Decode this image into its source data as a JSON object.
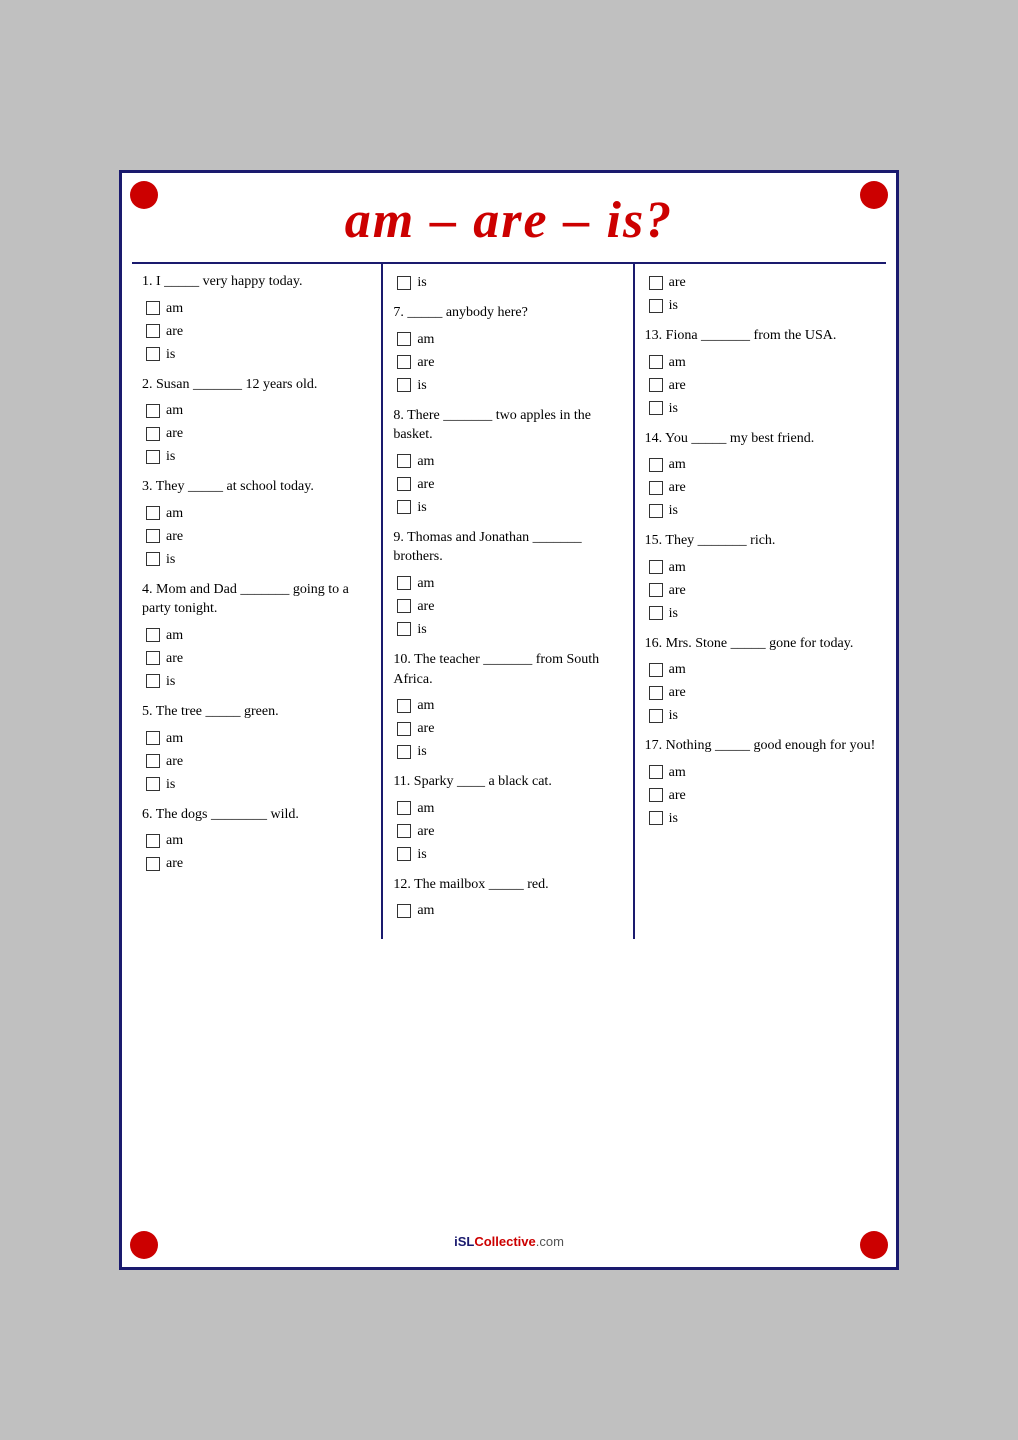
{
  "title": "am – are – is?",
  "watermark": "iSLCollective.com",
  "columns": [
    {
      "questions": [
        {
          "id": "q1",
          "text": "1. I _____ very happy today.",
          "options": [
            "am",
            "are",
            "is"
          ]
        },
        {
          "id": "q2",
          "text": "2. Susan _______ 12 years old.",
          "options": [
            "am",
            "are",
            "is"
          ]
        },
        {
          "id": "q3",
          "text": "3. They _____ at school today.",
          "options": [
            "am",
            "are",
            "is"
          ]
        },
        {
          "id": "q4",
          "text": "4. Mom and Dad _______ going to a party tonight.",
          "options": [
            "am",
            "are",
            "is"
          ]
        },
        {
          "id": "q5",
          "text": "5. The tree _____ green.",
          "options": [
            "am",
            "are",
            "is"
          ]
        },
        {
          "id": "q6",
          "text": "6. The dogs ________ wild.",
          "options": [
            "am",
            "are"
          ]
        }
      ]
    },
    {
      "questions": [
        {
          "id": "q7_pre",
          "text": "",
          "options": [
            "is"
          ]
        },
        {
          "id": "q7",
          "text": "7. _____ anybody here?",
          "options": [
            "am",
            "are",
            "is"
          ]
        },
        {
          "id": "q8",
          "text": "8. There _______ two apples in the basket.",
          "options": [
            "am",
            "are",
            "is"
          ]
        },
        {
          "id": "q9",
          "text": "9. Thomas and Jonathan _______ brothers.",
          "options": [
            "am",
            "are",
            "is"
          ]
        },
        {
          "id": "q10",
          "text": "10. The teacher _______ from South Africa.",
          "options": [
            "am",
            "are",
            "is"
          ]
        },
        {
          "id": "q11",
          "text": "11. Sparky ____ a black cat.",
          "options": [
            "am",
            "are",
            "is"
          ]
        },
        {
          "id": "q12",
          "text": "12. The mailbox _____ red.",
          "options": [
            "am"
          ]
        }
      ]
    },
    {
      "questions": [
        {
          "id": "q_pre1",
          "text": "",
          "options": [
            "are",
            "is"
          ]
        },
        {
          "id": "q13",
          "text": "13. Fiona _______ from the USA.",
          "options": [
            "am",
            "are",
            "is"
          ]
        },
        {
          "id": "q14",
          "text": "14. You _____ my best friend.",
          "options": [
            "am",
            "are",
            "is"
          ]
        },
        {
          "id": "q15",
          "text": "15. They _______ rich.",
          "options": [
            "am",
            "are",
            "is"
          ]
        },
        {
          "id": "q16",
          "text": "16. Mrs. Stone _____ gone for today.",
          "options": [
            "am",
            "are",
            "is"
          ]
        },
        {
          "id": "q17",
          "text": "17. Nothing _____ good enough for you!",
          "options": [
            "am",
            "are",
            "is"
          ]
        }
      ]
    }
  ]
}
